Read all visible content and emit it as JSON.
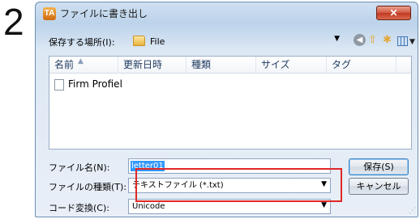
{
  "step_number": "2",
  "dialog": {
    "title": "ファイルに書き出し",
    "app_icon_text": "TA",
    "close_icon": "close-icon"
  },
  "location": {
    "label": "保存する場所(I):",
    "value": "File"
  },
  "toolbar": {
    "icons": [
      "back-icon",
      "up-folder-icon",
      "new-folder-icon",
      "views-menu-icon"
    ]
  },
  "file_list": {
    "columns": [
      "名前",
      "更新日時",
      "種類",
      "サイズ",
      "タグ"
    ],
    "items": [
      {
        "name": "Firm Profiel",
        "icon": "document-icon"
      }
    ]
  },
  "filename": {
    "label": "ファイル名(N):",
    "value": "letter01"
  },
  "filetype": {
    "label": "ファイルの種類(T):",
    "value": "テキストファイル (*.txt)"
  },
  "encoding": {
    "label": "コード変換(C):",
    "value": "Unicode"
  },
  "buttons": {
    "save": "保存(S)",
    "cancel": "キャンセル"
  },
  "colors": {
    "highlight_box": "#e02727",
    "selection": "#3399ff",
    "close_button": "#c13a22"
  }
}
